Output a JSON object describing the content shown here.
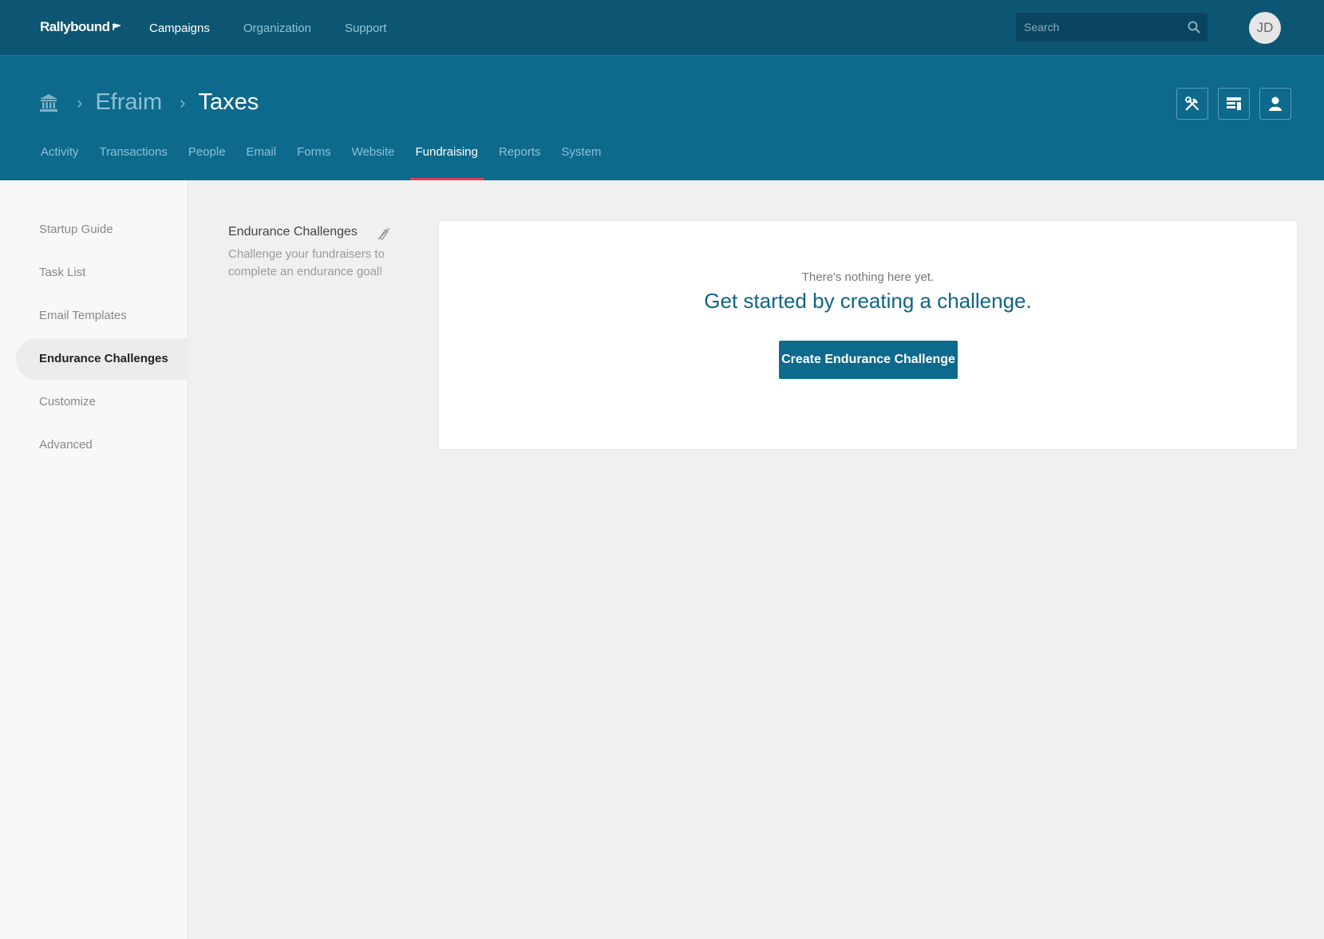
{
  "brand": {
    "logo_text": "Rallybound"
  },
  "topnav": {
    "items": [
      {
        "label": "Campaigns",
        "active": true
      },
      {
        "label": "Organization",
        "active": false
      },
      {
        "label": "Support",
        "active": false
      }
    ]
  },
  "search": {
    "placeholder": "Search",
    "icon": "search-icon"
  },
  "user": {
    "initials": "JD"
  },
  "breadcrumb": {
    "home_icon": "bank-icon",
    "org": "Efraim",
    "campaign": "Taxes"
  },
  "header_buttons": [
    "tools-icon",
    "layout-icon",
    "user-icon"
  ],
  "tabs": [
    {
      "label": "Activity",
      "active": false
    },
    {
      "label": "Transactions",
      "active": false
    },
    {
      "label": "People",
      "active": false
    },
    {
      "label": "Email",
      "active": false
    },
    {
      "label": "Forms",
      "active": false
    },
    {
      "label": "Website",
      "active": false
    },
    {
      "label": "Fundraising",
      "active": true
    },
    {
      "label": "Reports",
      "active": false
    },
    {
      "label": "System",
      "active": false
    }
  ],
  "sidebar": {
    "items": [
      {
        "label": "Startup Guide",
        "active": false
      },
      {
        "label": "Task List",
        "active": false
      },
      {
        "label": "Email Templates",
        "active": false
      },
      {
        "label": "Endurance Challenges",
        "active": true
      },
      {
        "label": "Customize",
        "active": false
      },
      {
        "label": "Advanced",
        "active": false
      }
    ]
  },
  "info": {
    "title": "Endurance Challenges",
    "description": "Challenge your fundraisers to complete an endurance goal!",
    "icon": "hide-help-icon"
  },
  "empty_state": {
    "subtitle": "There's nothing here yet.",
    "headline": "Get started by creating a challenge.",
    "button_label": "Create Endurance Challenge"
  },
  "colors": {
    "topbar": "#0d5673",
    "header": "#0e6a8d",
    "accent_underline": "#e23d5c",
    "primary_button": "#0e6a8d",
    "headline_text": "#0d6587"
  }
}
